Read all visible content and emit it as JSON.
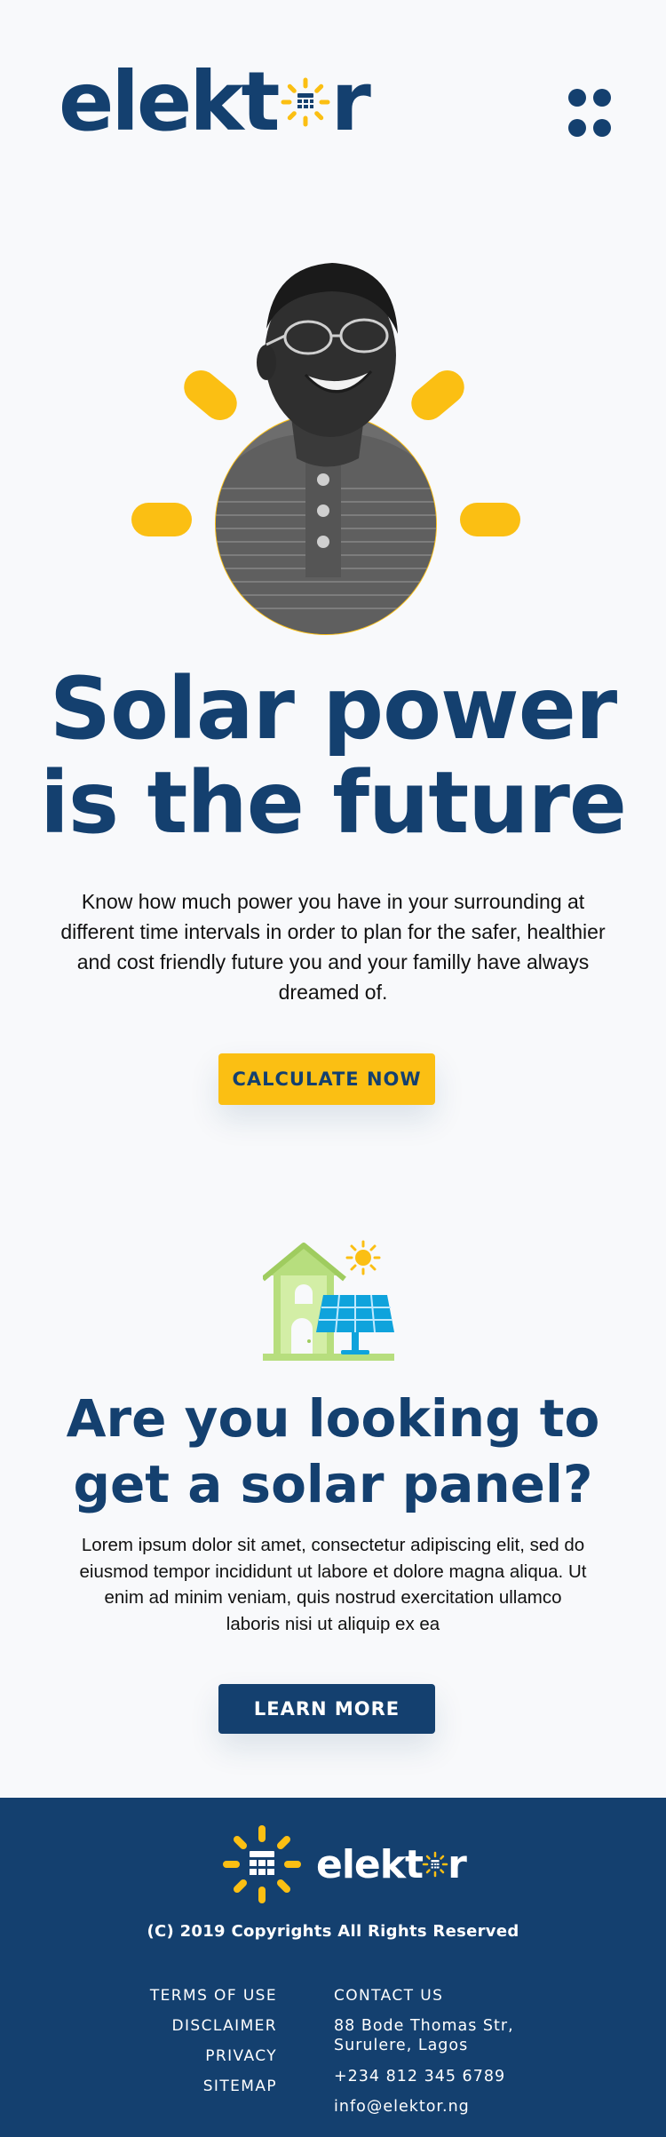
{
  "header": {
    "logo_prefix": "elekt",
    "logo_suffix": "r",
    "menu_icon": "grid-dots-icon"
  },
  "hero": {
    "title_line1": "Solar power",
    "title_line2": "is the future",
    "description": "Know how much power you have in your surrounding at different time intervals in order to plan for the safer, healthier and cost friendly future you and your familly have always dreamed of.",
    "cta_label": "CALCULATE NOW",
    "image_icon": "smiling-man-portrait"
  },
  "solar_section": {
    "title_line1": "Are you looking to",
    "title_line2": "get a solar panel?",
    "description": "Lorem ipsum dolor sit amet, consectetur adipiscing elit, sed do eiusmod tempor incididunt ut labore et dolore magna aliqua. Ut enim ad minim veniam, quis nostrud exercitation ullamco laboris nisi ut aliquip ex ea",
    "cta_label": "LEARN MORE",
    "illustration_icon": "house-solar-panel-icon"
  },
  "footer": {
    "logo_prefix": "elekt",
    "logo_suffix": "r",
    "copyright": "(C) 2019 Copyrights All Rights Reserved",
    "links": [
      "TERMS OF USE",
      "DISCLAIMER",
      "PRIVACY",
      "SITEMAP"
    ],
    "contact": {
      "title": "CONTACT US",
      "address_line1": "88 Bode Thomas Str,",
      "address_line2": "Surulere, Lagos",
      "phone": "+234 812 345 6789",
      "email": "info@elektor.ng"
    }
  },
  "colors": {
    "navy": "#14406f",
    "yellow": "#fbbf13",
    "background": "#f8f9fb"
  }
}
